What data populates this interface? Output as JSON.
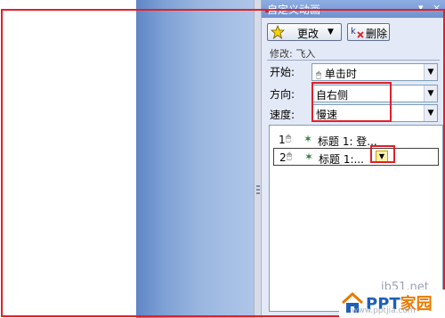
{
  "pane": {
    "title": "自定义动画",
    "dropdown_glyph": "▾",
    "close_glyph": "×"
  },
  "toolbar": {
    "change_label": "更改",
    "change_arrow": "▼",
    "delete_label": "删除"
  },
  "modify_label": "修改: 飞入",
  "fields": {
    "start_label": "开始:",
    "start_value": "单击时",
    "direction_label": "方向:",
    "direction_value": "自右侧",
    "speed_label": "速度:",
    "speed_value": "慢速"
  },
  "animation_list": [
    {
      "number": "1",
      "label": "标题 1: 登..."
    },
    {
      "number": "2",
      "label": "标题 1:..."
    }
  ],
  "watermark": {
    "site": "jb51.net",
    "logo_ppt": "PPT",
    "logo_text": "家园",
    "sub": "www.pptjia.com"
  },
  "colors": {
    "highlight": "#e0202a",
    "pane_bg": "#e3e9f6",
    "title_bar": "#7f9fd9"
  }
}
